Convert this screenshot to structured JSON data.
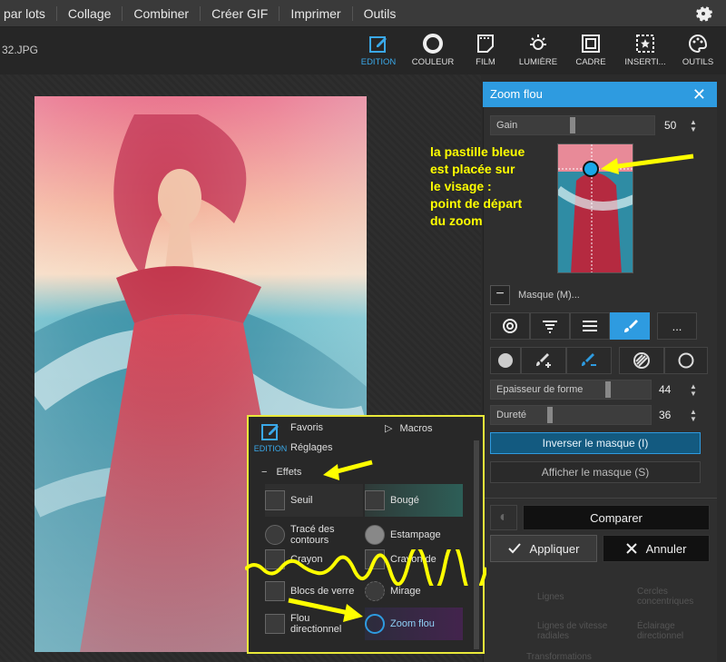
{
  "menu": {
    "items": [
      "par lots",
      "Collage",
      "Combiner",
      "Créer GIF",
      "Imprimer",
      "Outils"
    ]
  },
  "file": {
    "name": "32.JPG"
  },
  "toolbar": {
    "tools": [
      "EDITION",
      "COULEUR",
      "FILM",
      "LUMIÈRE",
      "CADRE",
      "INSERTI...",
      "OUTILS"
    ]
  },
  "panel": {
    "title": "Zoom flou",
    "gain": {
      "label": "Gain",
      "value": "50",
      "level": 0.5
    },
    "mask_label": "Masque (M)...",
    "more": "...",
    "epaisseur": {
      "label": "Epaisseur de forme",
      "value": "44",
      "level": 0.44
    },
    "durete": {
      "label": "Dureté",
      "value": "36",
      "level": 0.36
    },
    "invert": "Inverser le masque (I)",
    "show": "Afficher le masque (S)",
    "compare": "Comparer",
    "apply": "Appliquer",
    "cancel": "Annuler"
  },
  "annotation": {
    "lines": [
      "la pastille bleue",
      "est placée sur",
      "le visage :",
      "point de départ",
      "du zoom"
    ]
  },
  "popup": {
    "edition": "EDITION",
    "favoris": "Favoris",
    "macros": "Macros",
    "reglages": "Réglages",
    "effets": "Effets",
    "effects": [
      {
        "left": "Seuil",
        "right": "Bougé"
      },
      {
        "left": "Tracé des contours",
        "right": "Estampage"
      },
      {
        "left": "Crayon",
        "right": "Crayon de"
      },
      {
        "left": "Blocs de verre",
        "right": "Mirage"
      },
      {
        "left": "Flou directionnel",
        "right": "Zoom flou"
      }
    ]
  },
  "background_items": [
    "Lignes",
    "Cercles concentriques",
    "Lignes de vitesse radiales",
    "Éclairage directionnel",
    "Transformations"
  ],
  "colors": {
    "accent": "#2e9be0",
    "highlight": "#ffff00",
    "popup_border": "#e9e93a"
  }
}
